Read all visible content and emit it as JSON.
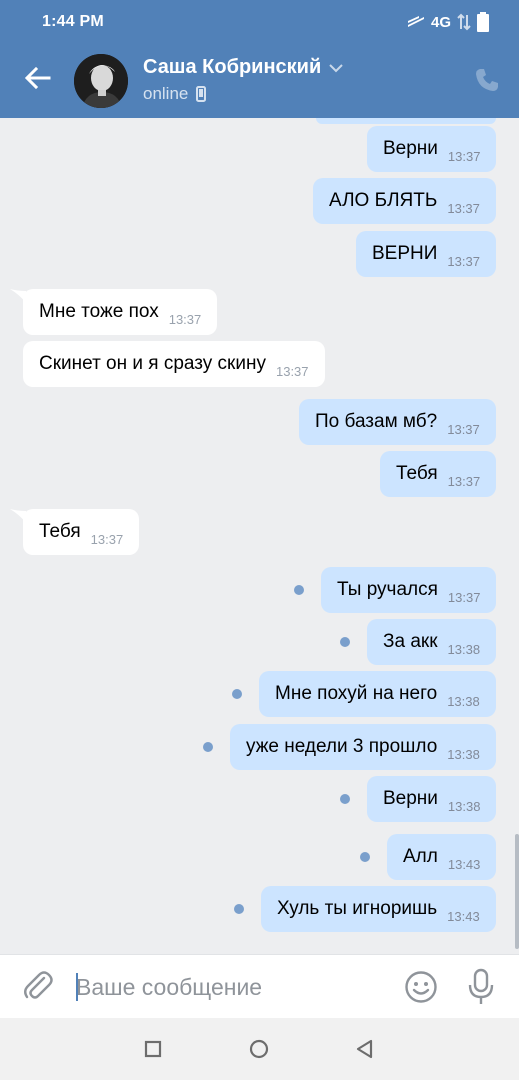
{
  "status_bar": {
    "time": "1:44 PM",
    "network": "4G"
  },
  "header": {
    "contact_name": "Саша Кобринский",
    "status": "online"
  },
  "messages": [
    {
      "dir": "out",
      "text": "Верни",
      "time": "13:37",
      "unread": false
    },
    {
      "dir": "out",
      "text": "АЛО БЛЯТЬ",
      "time": "13:37",
      "unread": false
    },
    {
      "dir": "out",
      "text": "ВЕРНИ",
      "time": "13:37",
      "unread": false
    },
    {
      "dir": "in",
      "text": "Мне тоже пох",
      "time": "13:37",
      "unread": false
    },
    {
      "dir": "in",
      "text": "Скинет он и я сразу скину",
      "time": "13:37",
      "unread": false
    },
    {
      "dir": "out",
      "text": "По базам мб?",
      "time": "13:37",
      "unread": false
    },
    {
      "dir": "out",
      "text": "Тебя",
      "time": "13:37",
      "unread": false
    },
    {
      "dir": "in",
      "text": "Тебя",
      "time": "13:37",
      "unread": false
    },
    {
      "dir": "out",
      "text": "Ты ручался",
      "time": "13:37",
      "unread": true
    },
    {
      "dir": "out",
      "text": "За акк",
      "time": "13:38",
      "unread": true
    },
    {
      "dir": "out",
      "text": "Мне похуй на него",
      "time": "13:38",
      "unread": true
    },
    {
      "dir": "out",
      "text": "уже недели 3 прошло",
      "time": "13:38",
      "unread": true
    },
    {
      "dir": "out",
      "text": "Верни",
      "time": "13:38",
      "unread": true
    },
    {
      "dir": "out",
      "text": "Алл",
      "time": "13:43",
      "unread": true
    },
    {
      "dir": "out",
      "text": "Хуль ты игноришь",
      "time": "13:43",
      "unread": true
    }
  ],
  "composer": {
    "placeholder": "Ваше сообщение"
  },
  "colors": {
    "header": "#5181b8",
    "outgoing_bubble": "#cce4ff",
    "incoming_bubble": "#ffffff",
    "background": "#edeef0",
    "unread_dot": "#7a9fcc"
  }
}
